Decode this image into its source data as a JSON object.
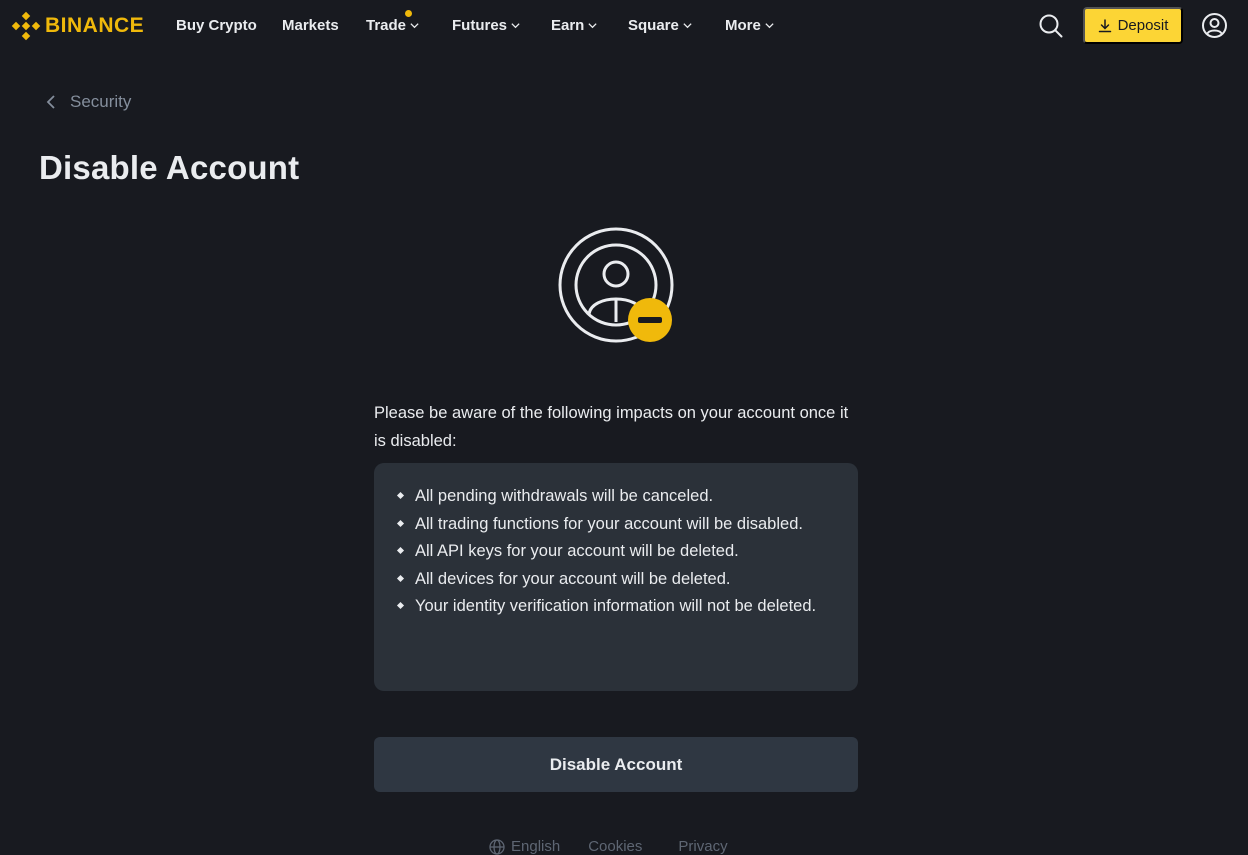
{
  "brand": {
    "name": "BINANCE",
    "color": "#f0b90b"
  },
  "nav": {
    "items": [
      {
        "label": "Buy Crypto",
        "dropdown": false
      },
      {
        "label": "Markets",
        "dropdown": false
      },
      {
        "label": "Trade",
        "dropdown": true,
        "has_dot": true
      },
      {
        "label": "Futures",
        "dropdown": true
      },
      {
        "label": "Earn",
        "dropdown": true
      },
      {
        "label": "Square",
        "dropdown": true
      },
      {
        "label": "More",
        "dropdown": true
      }
    ],
    "search_icon": "search-icon",
    "deposit_label": "Deposit",
    "deposit_icon": "download-icon",
    "profile_icon": "user-circle-icon"
  },
  "breadcrumb": {
    "back_label": "Security"
  },
  "page": {
    "title": "Disable Account",
    "illustration_icon": "user-disable-icon",
    "intro": "Please be aware of the following impacts on your account once it is disabled:",
    "impacts": [
      "All pending withdrawals will be canceled.",
      "All trading functions for your account will be disabled.",
      "All API keys for your account will be deleted.",
      "All devices for your account will be deleted.",
      "Your identity verification information will not be deleted."
    ],
    "action_button": "Disable Account"
  },
  "footer": {
    "language": "English",
    "links": [
      "Cookies",
      "Privacy"
    ]
  },
  "colors": {
    "background": "#181a20",
    "accent": "#fcd535",
    "panel": "#2b3139",
    "button": "#2f3742",
    "text_primary": "#eaecef",
    "text_secondary": "#848e9c"
  }
}
